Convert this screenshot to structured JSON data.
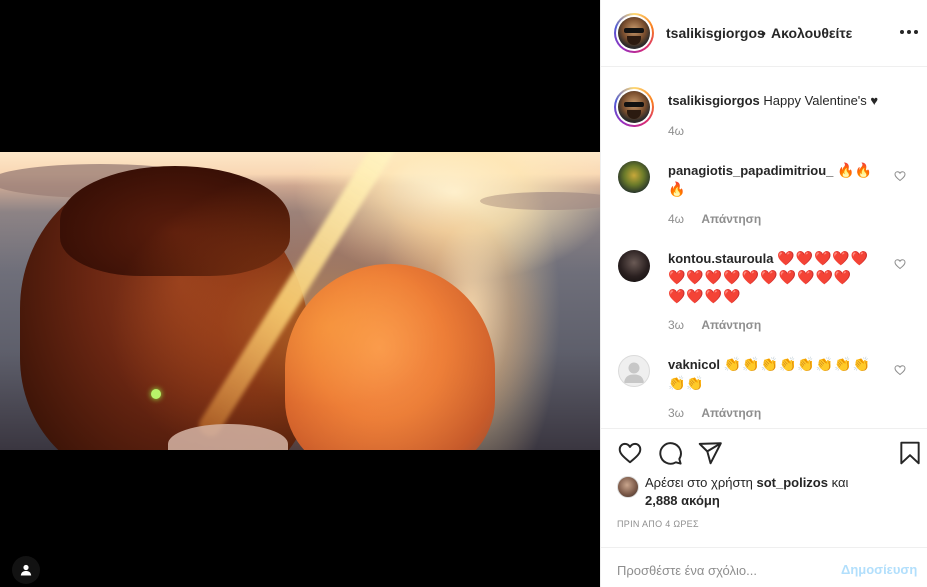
{
  "post": {
    "author": "tsalikisgiorgos",
    "follow_separator": "•",
    "follow_label": "Ακολουθείτε",
    "caption_text": "Happy Valentine's",
    "caption_heart": "♥",
    "caption_time": "4ω"
  },
  "comments": [
    {
      "user": "panagiotis_papadimitriou_",
      "emoji_line1": "🔥🔥",
      "emoji_line2": "🔥",
      "time": "4ω",
      "reply": "Απάντηση"
    },
    {
      "user": "kontou.stauroula",
      "emoji_line1": "❤️❤️❤️❤️❤️",
      "emoji_line2": "❤️❤️❤️❤️❤️❤️❤️❤️❤️❤️",
      "emoji_line3": "❤️❤️❤️❤️",
      "time": "3ω",
      "reply": "Απάντηση"
    },
    {
      "user": "vaknicol",
      "emoji_line1": "👏👏👏👏👏👏👏👏",
      "emoji_line2": "👏👏",
      "time": "3ω",
      "reply": "Απάντηση"
    }
  ],
  "likes": {
    "prefix": "Αρέσει στο χρήστη",
    "user": "sot_polizos",
    "and": "και",
    "count": "2,888 ακόμη"
  },
  "time_ago": "ΠΡΙΝ ΑΠΟ 4 ΩΡΕΣ",
  "comment_box": {
    "placeholder": "Προσθέστε ένα σχόλιο...",
    "post_label": "Δημοσίευση"
  },
  "colors": {
    "accent_link": "#b2dffc",
    "heart_red": "#e0143c",
    "meta_gray": "#8e8e8e"
  },
  "icons": [
    "more-icon",
    "like-heart-icon",
    "comment-icon",
    "share-icon",
    "bookmark-icon",
    "user-tag-icon",
    "comment-like-icon"
  ]
}
